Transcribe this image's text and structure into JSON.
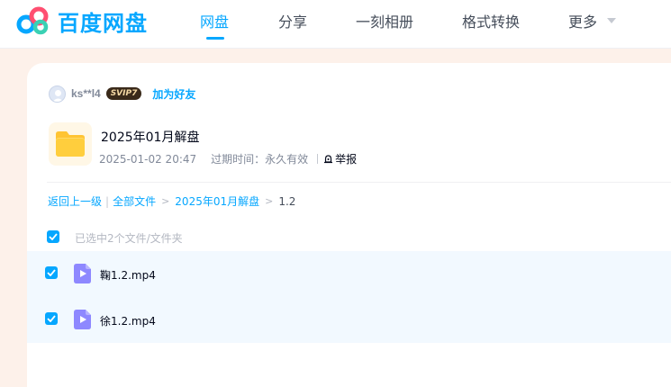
{
  "app": {
    "brand": "百度网盘",
    "accent": "#06a7ff"
  },
  "nav": {
    "items": [
      {
        "label": "网盘",
        "active": true
      },
      {
        "label": "分享",
        "active": false
      },
      {
        "label": "一刻相册",
        "active": false
      },
      {
        "label": "格式转换",
        "active": false
      },
      {
        "label": "更多",
        "active": false
      }
    ],
    "icons": {
      "more": "chevron-down-icon"
    }
  },
  "sharer": {
    "name": "ks**l4",
    "badge": "SVIP7",
    "add_friend_label": "加为好友"
  },
  "share": {
    "title": "2025年01月解盘",
    "date": "2025-01-02 20:47",
    "expire": "过期时间：永久有效",
    "report_label": "举报"
  },
  "breadcrumb": {
    "back": "返回上一级",
    "all_files": "全部文件",
    "folder": "2025年01月解盘",
    "current": "1.2"
  },
  "selection": {
    "summary": "已选中2个文件/文件夹",
    "all_checked": true
  },
  "files": [
    {
      "name": "鞠1.2.mp4",
      "type": "video",
      "checked": true
    },
    {
      "name": "徐1.2.mp4",
      "type": "video",
      "checked": true
    }
  ]
}
